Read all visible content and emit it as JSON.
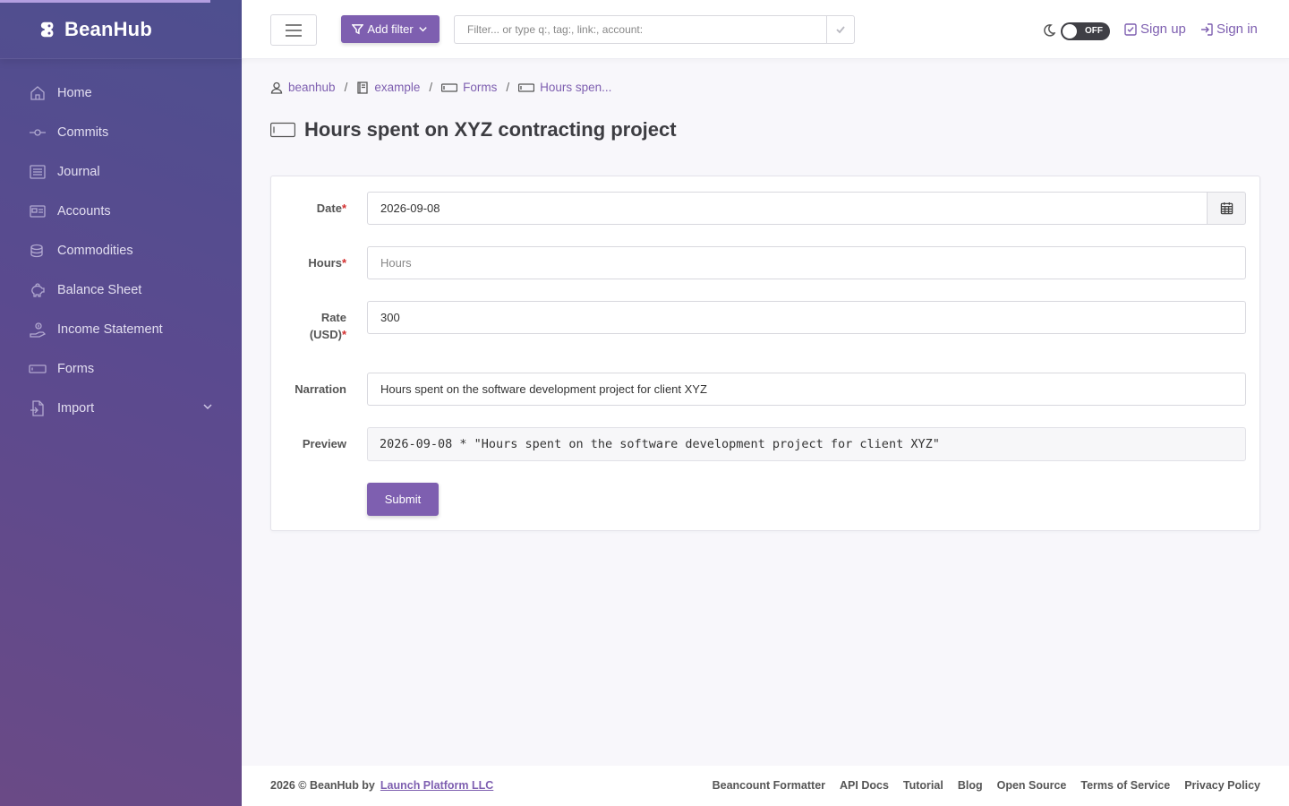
{
  "brand": {
    "name": "BeanHub"
  },
  "sidebar": {
    "items": [
      {
        "label": "Home",
        "icon": "home-icon"
      },
      {
        "label": "Commits",
        "icon": "commit-icon"
      },
      {
        "label": "Journal",
        "icon": "journal-icon"
      },
      {
        "label": "Accounts",
        "icon": "accounts-icon"
      },
      {
        "label": "Commodities",
        "icon": "coins-icon"
      },
      {
        "label": "Balance Sheet",
        "icon": "piggy-bank-icon"
      },
      {
        "label": "Income Statement",
        "icon": "income-icon"
      },
      {
        "label": "Forms",
        "icon": "form-icon"
      },
      {
        "label": "Import",
        "icon": "import-icon"
      }
    ]
  },
  "topbar": {
    "add_filter_label": "Add filter",
    "filter_placeholder": "Filter... or type q:, tag:, link:, account:",
    "toggle_label": "OFF",
    "sign_up_label": "Sign up",
    "sign_in_label": "Sign in"
  },
  "breadcrumb": {
    "items": [
      {
        "label": "beanhub",
        "icon": "user-icon"
      },
      {
        "label": "example",
        "icon": "book-icon"
      },
      {
        "label": "Forms",
        "icon": "form-icon"
      },
      {
        "label": "Hours spen...",
        "icon": "form-icon"
      }
    ]
  },
  "page": {
    "title": "Hours spent on XYZ contracting project"
  },
  "form": {
    "date": {
      "label": "Date",
      "value": "2026-09-08"
    },
    "hours": {
      "label": "Hours",
      "placeholder": "Hours",
      "value": ""
    },
    "rate": {
      "label_line1": "Rate",
      "label_line2": "(USD)",
      "value": "300"
    },
    "narration": {
      "label": "Narration",
      "value": "Hours spent on the software development project for client XYZ"
    },
    "preview": {
      "label": "Preview",
      "value": "2026-09-08 * \"Hours spent on the software development project for client XYZ\""
    },
    "submit_label": "Submit"
  },
  "footer": {
    "copyright": "2026 © BeanHub by",
    "company_link": "Launch Platform LLC",
    "links": [
      "Beancount Formatter",
      "API Docs",
      "Tutorial",
      "Blog",
      "Open Source",
      "Terms of Service",
      "Privacy Policy"
    ]
  },
  "colors": {
    "accent": "#7e5fb0",
    "sidebar_top": "#4e4f8f",
    "sidebar_bottom": "#6a4a86",
    "required": "#d32f2f"
  }
}
